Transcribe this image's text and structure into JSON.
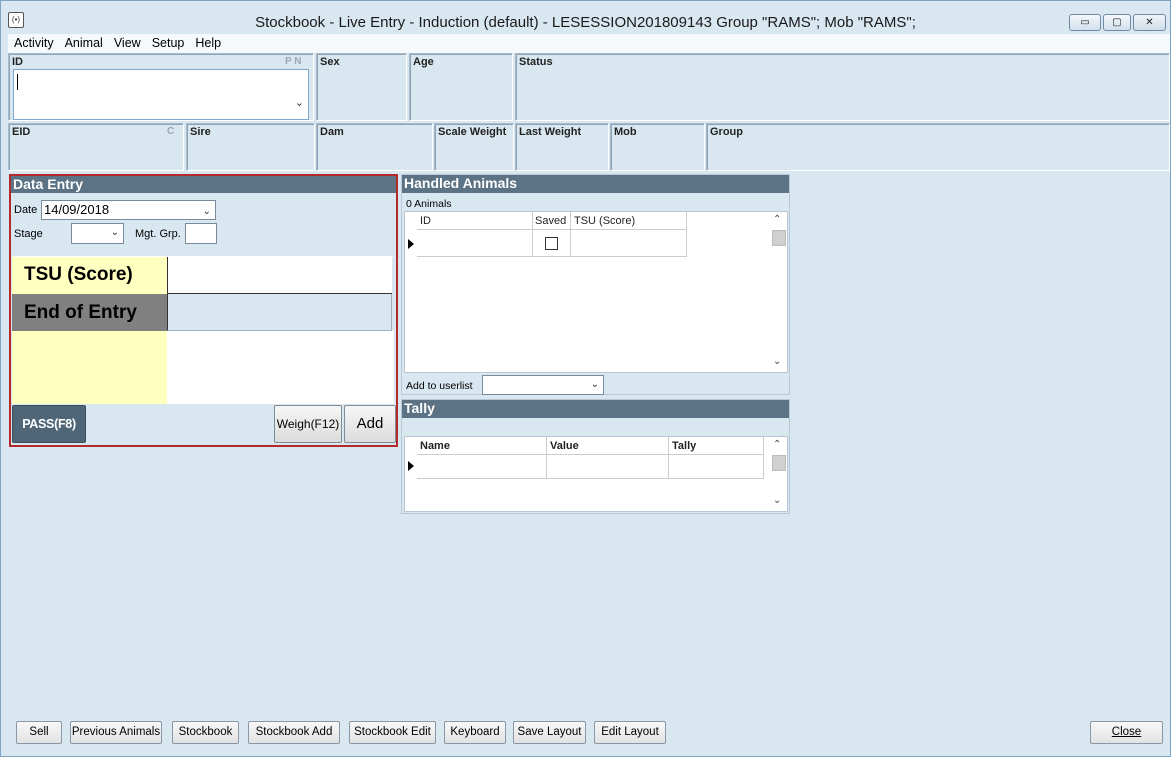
{
  "window": {
    "title": "Stockbook - Live Entry - Induction (default) - LESESSION201809143 Group \"RAMS\"; Mob \"RAMS\";",
    "controls": {
      "minimize": "▭",
      "maximize": "▢",
      "close": "✕"
    },
    "app_icon": "(•)"
  },
  "menu": {
    "items": [
      "Activity",
      "Animal",
      "View",
      "Setup",
      "Help"
    ]
  },
  "info_row1": {
    "id_label": "ID",
    "id_flags": "P  N",
    "id_value": "",
    "sex_label": "Sex",
    "age_label": "Age",
    "status_label": "Status"
  },
  "info_row2": {
    "eid_label": "EID",
    "eid_flag": "C",
    "sire_label": "Sire",
    "dam_label": "Dam",
    "scale_weight_label": "Scale Weight",
    "last_weight_label": "Last Weight",
    "mob_label": "Mob",
    "group_label": "Group"
  },
  "data_entry": {
    "header": "Data Entry",
    "date_label": "Date",
    "date_value": "14/09/2018",
    "stage_label": "Stage",
    "mgt_grp_label": "Mgt. Grp.",
    "rows": [
      {
        "label": "TSU (Score)",
        "value": ""
      },
      {
        "label": "End of Entry",
        "value": ""
      },
      {
        "label": "",
        "value": ""
      }
    ],
    "pass_button": "PASS(F8)",
    "weigh_button": "Weigh(F12)",
    "add_button": "Add"
  },
  "handled_animals": {
    "header": "Handled Animals",
    "count": "0 Animals",
    "columns": [
      "ID",
      "Saved",
      "TSU (Score)"
    ],
    "add_to_userlist_label": "Add to userlist"
  },
  "tally": {
    "header": "Tally",
    "columns": [
      "Name",
      "Value",
      "Tally"
    ]
  },
  "bottom_buttons": {
    "sell": "Sell",
    "previous_animals": "Previous Animals",
    "stockbook": "Stockbook",
    "stockbook_add": "Stockbook Add",
    "stockbook_edit": "Stockbook Edit",
    "keyboard": "Keyboard",
    "save_layout": "Save Layout",
    "edit_layout": "Edit Layout",
    "close": "Close"
  },
  "colors": {
    "background": "#d9e7f0",
    "panel_header": "#5b7385",
    "highlight_yellow": "#ffffc0",
    "end_entry_gray": "#808080",
    "pass_button": "#4f6678",
    "focus_border": "#b42a2a"
  }
}
